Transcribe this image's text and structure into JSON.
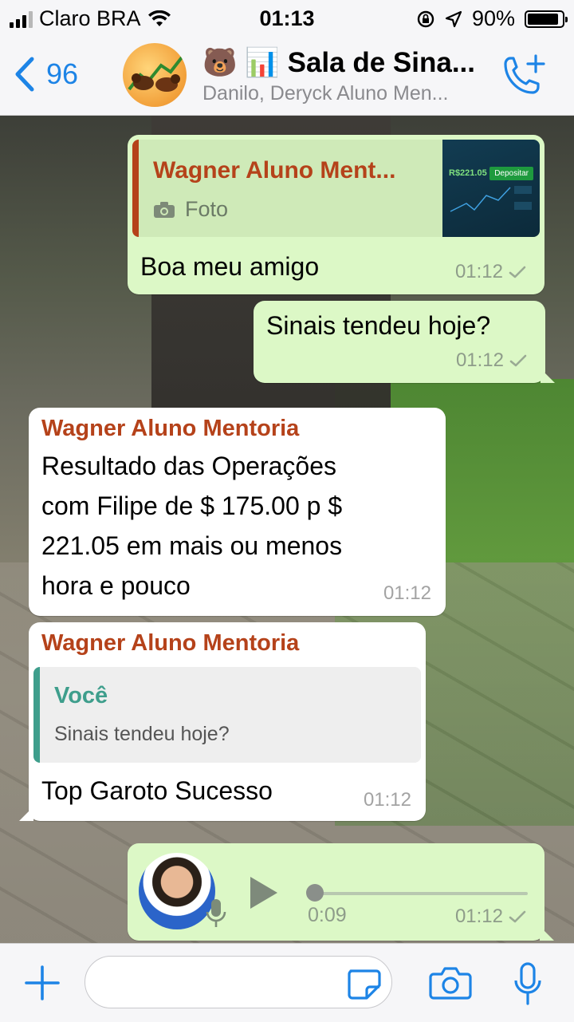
{
  "status_bar": {
    "carrier": "Claro BRA",
    "time": "01:13",
    "battery": "90%",
    "battery_level": 0.9
  },
  "header": {
    "back_count": "96",
    "title": "🐻 📊 Sala de Sina...",
    "subtitle": "Danilo, Deryck Aluno Men..."
  },
  "messages": [
    {
      "direction": "outgoing",
      "quote_sender": "Wagner Aluno Ment...",
      "quote_text": "Foto",
      "quote_thumb_text": "R$221.05",
      "quote_thumb_button": "Depositar",
      "text": "Boa meu amigo",
      "time": "01:12"
    },
    {
      "direction": "outgoing",
      "text": "Sinais tendeu hoje?",
      "time": "01:12"
    },
    {
      "direction": "incoming",
      "sender": "Wagner Aluno Mentoria",
      "lines": [
        "Resultado das Operações",
        "com Filipe de $ 175.00 p $",
        "221.05 em mais ou menos",
        "hora e pouco"
      ],
      "time": "01:12"
    },
    {
      "direction": "incoming",
      "sender": "Wagner Aluno Mentoria",
      "quote_sender": "Você",
      "quote_text": "Sinais tendeu hoje?",
      "text": "Top Garoto Sucesso",
      "time": "01:12"
    },
    {
      "direction": "outgoing",
      "type": "voice",
      "duration": "0:09",
      "time": "01:12",
      "progress": 0
    }
  ],
  "input_bar": {
    "placeholder": ""
  },
  "colors": {
    "accent": "#1d84e6",
    "outgoing_bubble": "#dcf8c6",
    "incoming_bubble": "#ffffff",
    "sender_name": "#b5421a",
    "quote_you": "#3e9e8c"
  }
}
